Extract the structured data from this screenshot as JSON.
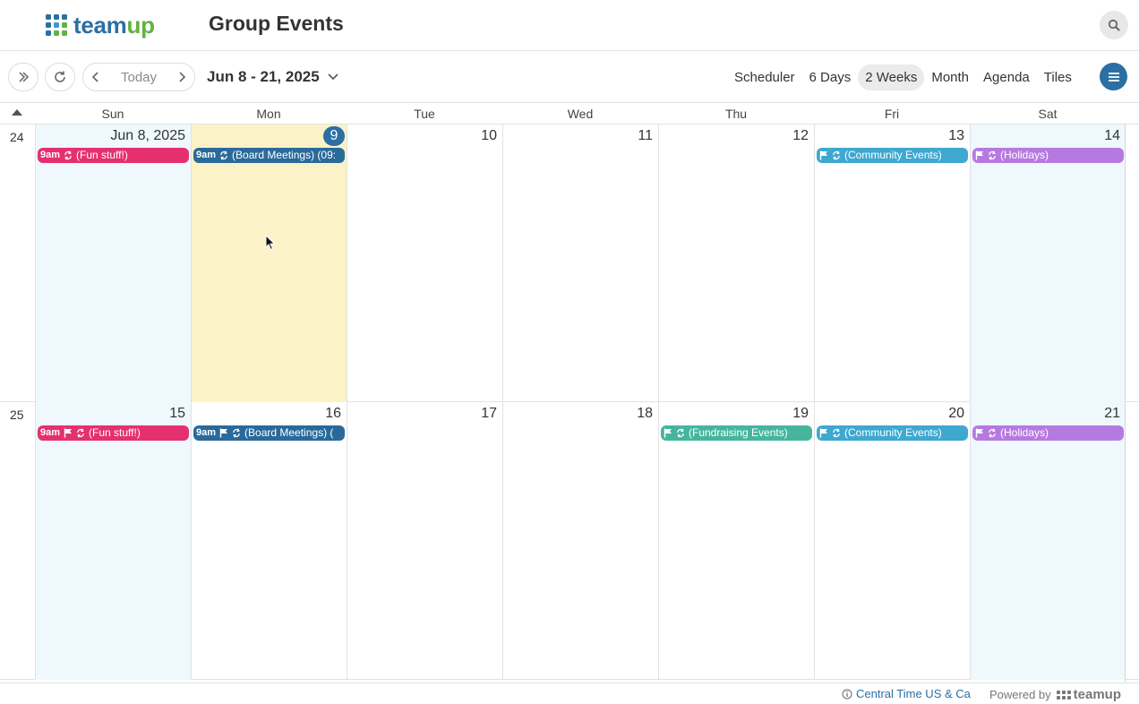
{
  "header": {
    "logo": {
      "part1": "team",
      "part2": "up"
    },
    "title": "Group Events",
    "search_icon": "search-icon"
  },
  "toolbar": {
    "today_label": "Today",
    "date_range": "Jun 8 - 21, 2025",
    "views": [
      {
        "label": "Scheduler",
        "active": false
      },
      {
        "label": "6 Days",
        "active": false
      },
      {
        "label": "2 Weeks",
        "active": true
      },
      {
        "label": "Month",
        "active": false
      },
      {
        "label": "Agenda",
        "active": false
      },
      {
        "label": "Tiles",
        "active": false
      }
    ]
  },
  "calendar": {
    "days_of_week": [
      "Sun",
      "Mon",
      "Tue",
      "Wed",
      "Thu",
      "Fri",
      "Sat"
    ],
    "weeks": [
      {
        "number": "24",
        "days": [
          {
            "label": "Jun 8, 2025",
            "weekend": true,
            "today": false,
            "event": {
              "time": "9am",
              "flag": false,
              "text": "(Fun stuff!)",
              "color": "#e5306f"
            }
          },
          {
            "label": "9",
            "weekend": false,
            "today": true,
            "event": {
              "time": "9am",
              "flag": false,
              "text": "(Board Meetings) (09:",
              "color": "#2a6a9b"
            }
          },
          {
            "label": "10",
            "weekend": false,
            "today": false,
            "event": null
          },
          {
            "label": "11",
            "weekend": false,
            "today": false,
            "event": null
          },
          {
            "label": "12",
            "weekend": false,
            "today": false,
            "event": null
          },
          {
            "label": "13",
            "weekend": false,
            "today": false,
            "event": {
              "time": "",
              "flag": true,
              "text": "(Community Events)",
              "color": "#3ea8cf"
            }
          },
          {
            "label": "14",
            "weekend": true,
            "today": false,
            "event": {
              "time": "",
              "flag": true,
              "text": "(Holidays)",
              "color": "#b57ae0"
            }
          }
        ]
      },
      {
        "number": "25",
        "days": [
          {
            "label": "15",
            "weekend": true,
            "today": false,
            "event": {
              "time": "9am",
              "flag": true,
              "text": "(Fun stuff!)",
              "color": "#e5306f"
            }
          },
          {
            "label": "16",
            "weekend": false,
            "today": false,
            "event": {
              "time": "9am",
              "flag": true,
              "text": "(Board Meetings) (",
              "color": "#2a6a9b"
            }
          },
          {
            "label": "17",
            "weekend": false,
            "today": false,
            "event": null
          },
          {
            "label": "18",
            "weekend": false,
            "today": false,
            "event": null
          },
          {
            "label": "19",
            "weekend": false,
            "today": false,
            "event": {
              "time": "",
              "flag": true,
              "text": "(Fundraising Events)",
              "color": "#45b59e"
            }
          },
          {
            "label": "20",
            "weekend": false,
            "today": false,
            "event": {
              "time": "",
              "flag": true,
              "text": "(Community Events)",
              "color": "#3ea8cf"
            }
          },
          {
            "label": "21",
            "weekend": true,
            "today": false,
            "event": {
              "time": "",
              "flag": true,
              "text": "(Holidays)",
              "color": "#b57ae0"
            }
          }
        ]
      }
    ]
  },
  "footer": {
    "timezone": "Central Time US & Ca",
    "powered_by": "Powered by",
    "brand": "teamup"
  },
  "colors": {
    "brand_blue": "#2b6fa3",
    "brand_green": "#62b23f",
    "weekend_bg": "#eef8fd",
    "today_bg": "#fbf2c7"
  }
}
